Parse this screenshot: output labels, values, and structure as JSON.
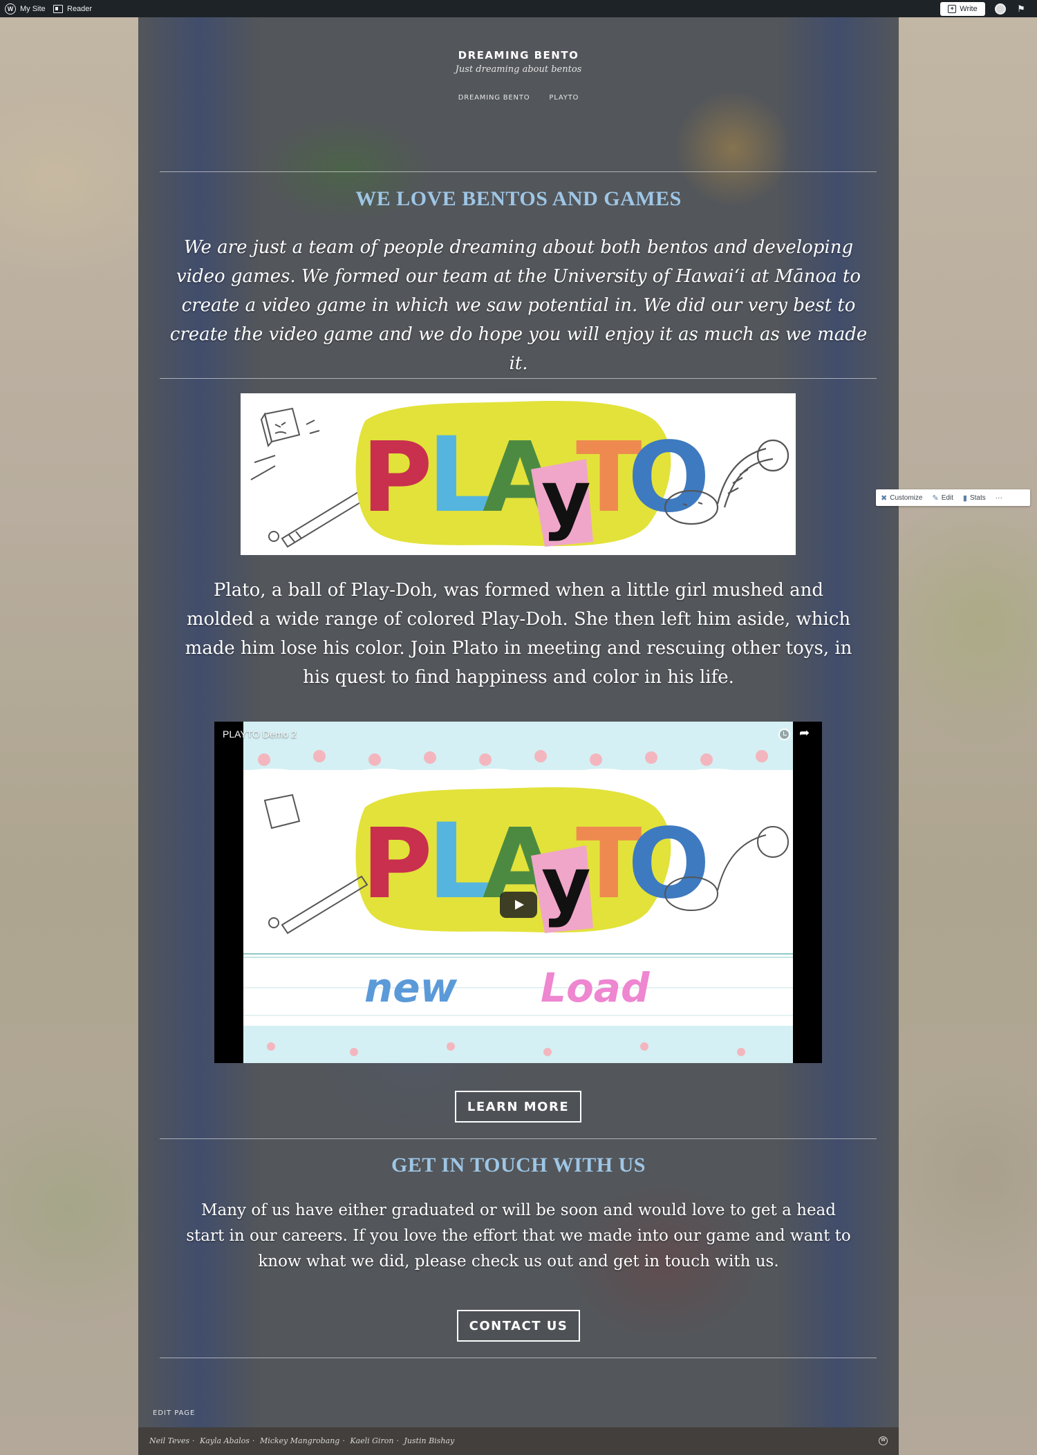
{
  "admin_bar": {
    "my_site": "My Site",
    "reader": "Reader",
    "write": "Write"
  },
  "site": {
    "title": "DREAMING BENTO",
    "tagline": "Just dreaming about bentos",
    "nav": [
      "DREAMING BENTO",
      "PLAYTO"
    ]
  },
  "intro": {
    "heading": "WE LOVE BENTOS AND GAMES",
    "text": "We are just a team of people dreaming about both bentos and developing video games. We formed our team at the University of Hawaiʻi at Mānoa to create a video game in which we saw potential in. We did our very best to create the video game and we do hope you will enjoy it as much as we made it."
  },
  "game": {
    "logo_letters": [
      "P",
      "L",
      "A",
      "y",
      "T",
      "O"
    ],
    "logo_colors": [
      "#c8304e",
      "#56b5de",
      "#4c8a42",
      "#f0a6c8",
      "#ee8a50",
      "#3e7ac0"
    ],
    "description": "Plato, a ball of Play-Doh, was formed when a little girl mushed and molded a wide range of colored Play-Doh. She then left him aside, which made him lose his color. Join Plato in meeting and rescuing other toys, in his quest to find happiness and color in his life.",
    "video_title": "PLAYTO Demo 2",
    "video_menu": [
      "new",
      "Load"
    ],
    "learn_more": "LEARN MORE"
  },
  "contact": {
    "heading": "GET IN TOUCH WITH US",
    "text": "Many of us have either graduated or will be soon and would love to get a head start in our careers. If you love the effort that we made into our game and want to know what we did, please check us out and get in touch with us.",
    "button": "CONTACT US"
  },
  "edit_page": "EDIT PAGE",
  "footer": {
    "credits": [
      "Neil Teves",
      "Kayla Abalos",
      "Mickey Mangrobang",
      "Kaeli Giron",
      "Justin Bishay"
    ]
  },
  "float_toolbar": {
    "customize": "Customize",
    "edit": "Edit",
    "stats": "Stats",
    "more": "···"
  },
  "colors": {
    "heading": "#9ec6e6",
    "admin_bar": "#1d2327",
    "footer": "#423f3c",
    "logo_blob": "#e2e23a"
  }
}
